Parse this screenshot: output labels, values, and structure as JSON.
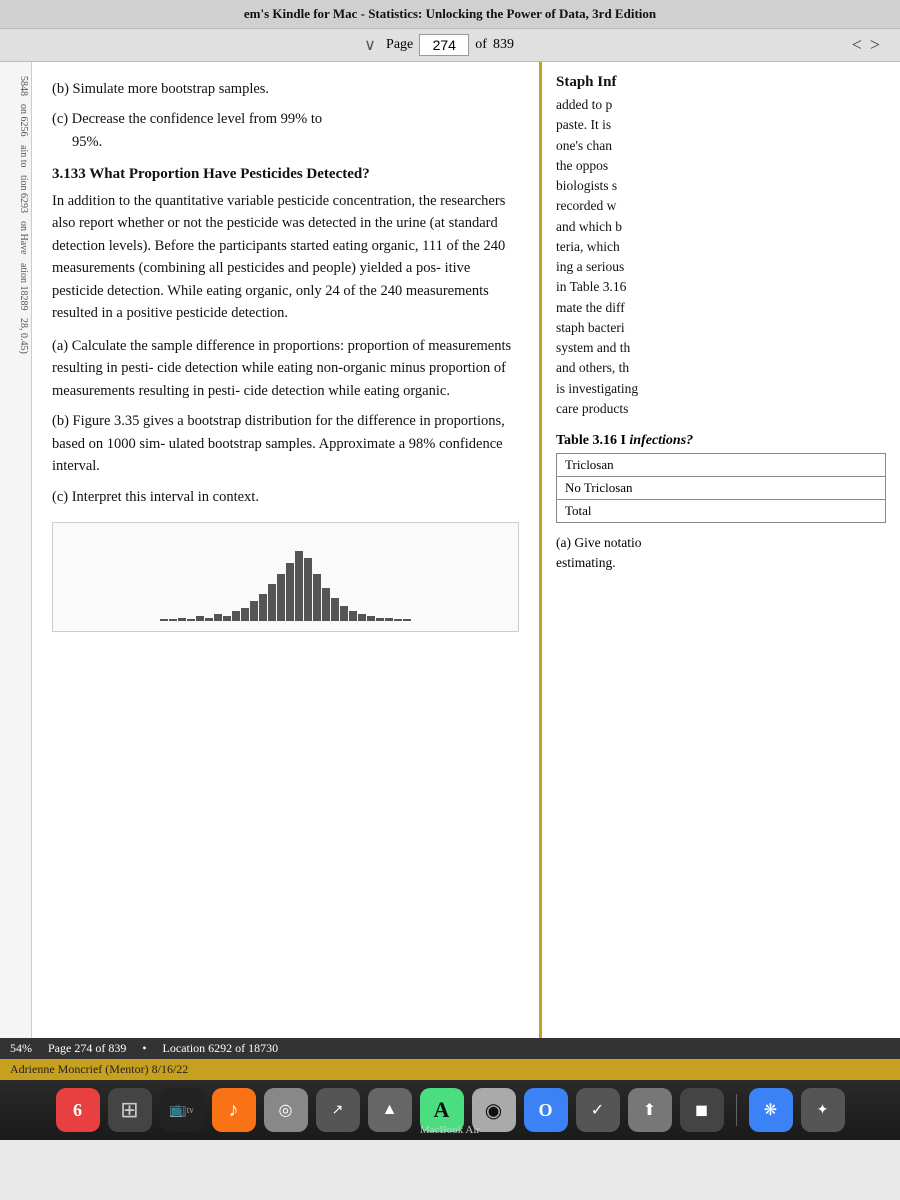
{
  "titleBar": {
    "text": "em's Kindle for Mac - Statistics: Unlocking the Power of Data, 3rd Edition"
  },
  "navBar": {
    "pageLabel": "Page",
    "pageNumber": "274",
    "ofLabel": "of",
    "totalPages": "839",
    "chevronLeft": "<",
    "chevronRight": ">",
    "downArrow": "∨"
  },
  "leftSidebar": {
    "items": [
      {
        "label": "5848"
      },
      {
        "label": "on 6256"
      },
      {
        "label": "ain to"
      },
      {
        "label": "tion 6293"
      },
      {
        "label": "on Have"
      },
      {
        "label": "ation 18289"
      },
      {
        "label": "28, 0.45)"
      }
    ]
  },
  "mainContent": {
    "partB": "(b) Simulate more bootstrap samples.",
    "partC_start": "(c) Decrease the confidence level from 99% to",
    "partC_end": "95%.",
    "sectionNumber": "3.133",
    "sectionTitle": "What Proportion Have Pesticides Detected?",
    "body1": "In addition to the quantitative variable pesticide concentration, the researchers also report whether or not the pesticide was detected in the urine (at standard detection levels). Before the participants started eating organic, 111 of the 240 measurements (combining all pesticides and people) yielded a pos- itive pesticide detection. While eating organic, only 24 of the 240 measurements resulted in a positive pesticide detection.",
    "subPartA_label": "(a)",
    "subPartA_text": "Calculate the sample difference in proportions: proportion of measurements resulting in pesti- cide detection while eating non-organic minus proportion of measurements resulting in pesti- cide detection while eating organic.",
    "subPartB_label": "(b)",
    "subPartB_text": "Figure 3.35 gives a bootstrap distribution for the difference in proportions, based on 1000 sim- ulated bootstrap samples. Approximate a 98% confidence interval.",
    "subPartC_label": "(c)",
    "subPartC_text": "Interpret this interval in context.",
    "chartBars": [
      1,
      1,
      2,
      1,
      3,
      2,
      4,
      3,
      6,
      8,
      12,
      16,
      22,
      28,
      35,
      42,
      38,
      28,
      20,
      14,
      9,
      6,
      4,
      3,
      2,
      2,
      1,
      1
    ]
  },
  "rightPanel": {
    "title": "Staph Inf",
    "lines": [
      "added to p",
      "paste. It is",
      "one's chan",
      "the oppos",
      "biologists s",
      "recorded w",
      "and which b",
      "teria, which",
      "ing a serious",
      "in Table 3.16",
      "mate the diff",
      "staph bacteri",
      "system and th",
      "and others, th",
      "is investigating",
      "care products"
    ],
    "tableTitle": "Table 3.16 I",
    "tableSubtitle": "infections?",
    "tableHeaders": [
      ""
    ],
    "tableRows": [
      [
        "Triclosan"
      ],
      [
        "No Triclosan"
      ],
      [
        "Total"
      ]
    ],
    "giveNotation": "(a) Give notatio",
    "estimating": "estimating."
  },
  "statusBar": {
    "percent": "54%",
    "pageInfo": "Page 274 of 839",
    "bullet": "•",
    "location": "Location 6292 of 18730"
  },
  "userBar": {
    "text": "Adrienne Moncrief (Mentor)  8/16/22"
  },
  "dock": {
    "items": [
      {
        "icon": "6",
        "bg": "#e84040",
        "label": ""
      },
      {
        "icon": "⊞",
        "bg": "#555",
        "label": ""
      },
      {
        "icon": "📺",
        "bg": "#333",
        "label": "tv"
      },
      {
        "icon": "♪",
        "bg": "#f97316",
        "label": ""
      },
      {
        "icon": "◎",
        "bg": "#aaa",
        "label": ""
      },
      {
        "icon": "↗",
        "bg": "#555",
        "label": ""
      },
      {
        "icon": "▲",
        "bg": "#888",
        "label": ""
      },
      {
        "icon": "A",
        "bg": "#4ade80",
        "label": ""
      },
      {
        "icon": "◉",
        "bg": "#aaa",
        "label": ""
      },
      {
        "icon": "O",
        "bg": "#3b82f6",
        "label": ""
      },
      {
        "icon": "✓",
        "bg": "#555",
        "label": ""
      },
      {
        "icon": "⬆",
        "bg": "#888",
        "label": ""
      },
      {
        "icon": "◼",
        "bg": "#555",
        "label": ""
      },
      {
        "icon": "❋",
        "bg": "#3b82f6",
        "label": ""
      },
      {
        "icon": "✦",
        "bg": "#555",
        "label": ""
      }
    ],
    "macbookLabel": "MacBook Air"
  }
}
